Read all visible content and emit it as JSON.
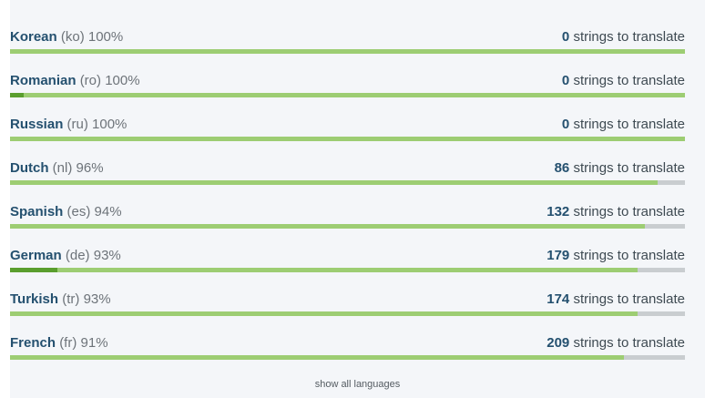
{
  "languages": [
    {
      "name": "Korean",
      "code": "(ko)",
      "percent": "100%",
      "count": "0",
      "suffix": "strings to translate",
      "progress": 1.0,
      "reviewed": 0.0
    },
    {
      "name": "Romanian",
      "code": "(ro)",
      "percent": "100%",
      "count": "0",
      "suffix": "strings to translate",
      "progress": 1.0,
      "reviewed": 0.02
    },
    {
      "name": "Russian",
      "code": "(ru)",
      "percent": "100%",
      "count": "0",
      "suffix": "strings to translate",
      "progress": 1.0,
      "reviewed": 0.0
    },
    {
      "name": "Dutch",
      "code": "(nl)",
      "percent": "96%",
      "count": "86",
      "suffix": "strings to translate",
      "progress": 0.96,
      "reviewed": 0.0
    },
    {
      "name": "Spanish",
      "code": "(es)",
      "percent": "94%",
      "count": "132",
      "suffix": "strings to translate",
      "progress": 0.94,
      "reviewed": 0.0
    },
    {
      "name": "German",
      "code": "(de)",
      "percent": "93%",
      "count": "179",
      "suffix": "strings to translate",
      "progress": 0.93,
      "reviewed": 0.07
    },
    {
      "name": "Turkish",
      "code": "(tr)",
      "percent": "93%",
      "count": "174",
      "suffix": "strings to translate",
      "progress": 0.93,
      "reviewed": 0.0
    },
    {
      "name": "French",
      "code": "(fr)",
      "percent": "91%",
      "count": "209",
      "suffix": "strings to translate",
      "progress": 0.91,
      "reviewed": 0.0
    }
  ],
  "show_all_label": "show all languages",
  "colors": {
    "fill": "#9dcd73",
    "reviewed": "#5a9e2e",
    "track": "#c9cdd0",
    "name": "#24506f"
  }
}
